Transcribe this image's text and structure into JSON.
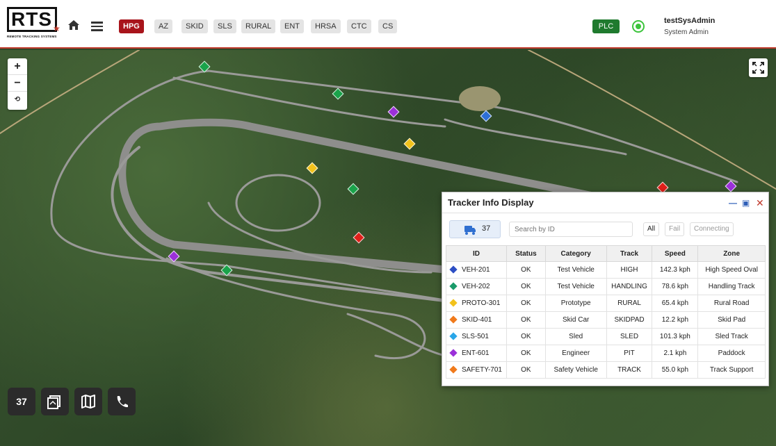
{
  "header": {
    "logo_text": "RTS",
    "logo_subtitle": "REMOTE TRACKING SYSTEMS",
    "nav_tabs": [
      "HPG",
      "AZ",
      "SKID",
      "SLS",
      "RURAL",
      "ENT",
      "HRSA",
      "CTC",
      "CS"
    ],
    "active_tab": "HPG",
    "plc_label": "PLC",
    "user_name": "testSysAdmin",
    "user_role": "System Admin"
  },
  "map": {
    "zoom_in": "+",
    "zoom_out": "−",
    "reset": "⟲",
    "markers": [
      {
        "color": "#1aa34a"
      },
      {
        "color": "#1aa34a"
      },
      {
        "color": "#9b30d9"
      },
      {
        "color": "#2d6fd6"
      },
      {
        "color": "#f2c21c"
      },
      {
        "color": "#f2c21c"
      },
      {
        "color": "#1aa34a"
      },
      {
        "color": "#e0201a"
      },
      {
        "color": "#9b30d9"
      },
      {
        "color": "#1aa34a"
      },
      {
        "color": "#e0201a"
      },
      {
        "color": "#9b30d9"
      }
    ]
  },
  "toolbar": {
    "count": "37"
  },
  "tracker_panel": {
    "title": "Tracker Info Display",
    "count": "37",
    "search_placeholder": "Search by ID",
    "filters": [
      "All",
      "Fail",
      "Connecting"
    ],
    "columns": [
      "ID",
      "Status",
      "Category",
      "Track",
      "Speed",
      "Zone"
    ],
    "rows": [
      {
        "color": "#2d4fc4",
        "id": "VEH-201",
        "status": "OK",
        "category": "Test Vehicle",
        "track": "HIGH",
        "speed": "142.3 kph",
        "zone": "High Speed Oval"
      },
      {
        "color": "#1a9b6a",
        "id": "VEH-202",
        "status": "OK",
        "category": "Test Vehicle",
        "track": "HANDLING",
        "speed": "78.6 kph",
        "zone": "Handling Track"
      },
      {
        "color": "#f2c21c",
        "id": "PROTO-301",
        "status": "OK",
        "category": "Prototype",
        "track": "RURAL",
        "speed": "65.4 kph",
        "zone": "Rural Road"
      },
      {
        "color": "#f07a1c",
        "id": "SKID-401",
        "status": "OK",
        "category": "Skid Car",
        "track": "SKIDPAD",
        "speed": "12.2 kph",
        "zone": "Skid Pad"
      },
      {
        "color": "#2aa6e8",
        "id": "SLS-501",
        "status": "OK",
        "category": "Sled",
        "track": "SLED",
        "speed": "101.3 kph",
        "zone": "Sled Track"
      },
      {
        "color": "#9b30d9",
        "id": "ENT-601",
        "status": "OK",
        "category": "Engineer",
        "track": "PIT",
        "speed": "2.1 kph",
        "zone": "Paddock"
      },
      {
        "color": "#f07a1c",
        "id": "SAFETY-701",
        "status": "OK",
        "category": "Safety Vehicle",
        "track": "TRACK",
        "speed": "55.0 kph",
        "zone": "Track Support"
      }
    ]
  }
}
